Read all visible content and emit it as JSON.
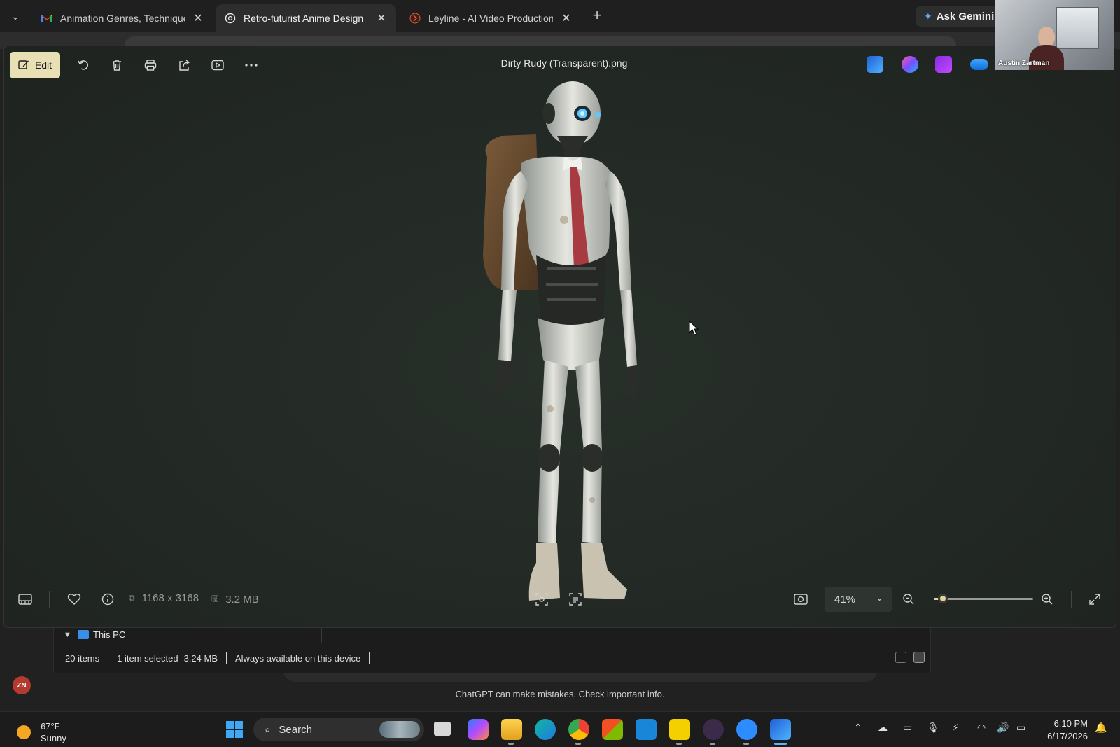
{
  "browser": {
    "tabs": [
      {
        "title": "Animation Genres, Technique an",
        "favicon": "gmail-icon",
        "active": false
      },
      {
        "title": "Retro-futurist Anime Design",
        "favicon": "chatgpt-icon",
        "active": true
      },
      {
        "title": "Leyline - AI Video Production P",
        "favicon": "leyline-icon",
        "active": false
      }
    ],
    "gemini_label": "Ask Gemini"
  },
  "webcam": {
    "name": "Austin Zartman"
  },
  "photos": {
    "toolbar": {
      "edit_label": "Edit",
      "file_title": "Dirty Rudy (Transparent).png"
    },
    "info": {
      "dimensions": "1168 x 3168",
      "file_size": "3.2 MB"
    },
    "zoom": {
      "value_label": "41%",
      "fraction": 0.09
    }
  },
  "explorer": {
    "tree_item": "This PC",
    "status": {
      "items": "20 items",
      "selected": "1 item selected",
      "size": "3.24 MB",
      "availability": "Always available on this device"
    }
  },
  "chatgpt": {
    "avatar_initials": "ZN",
    "disclaimer": "ChatGPT can make mistakes. Check important info."
  },
  "taskbar": {
    "weather_temp": "67°F",
    "weather_cond": "Sunny",
    "search_label": "Search",
    "time": "6:10 PM",
    "date": "6/17/2026"
  },
  "colors": {
    "edit_accent": "#e9dfb5",
    "slider_accent": "#e4d49a",
    "viewer_bg": "#222823"
  }
}
